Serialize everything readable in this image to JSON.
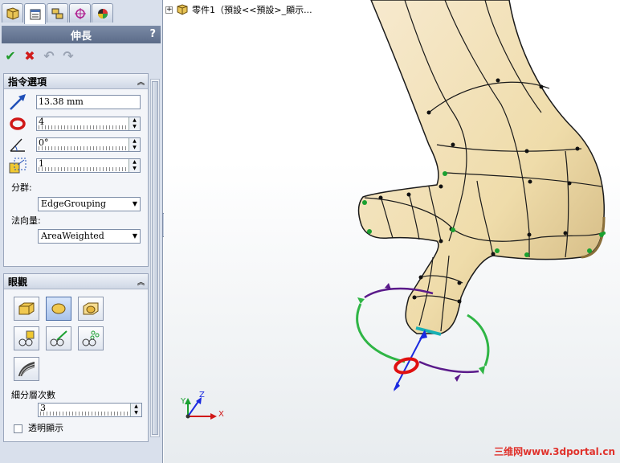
{
  "tabs": [
    "feature-manager",
    "property-manager",
    "configuration-manager",
    "dimxpert-manager",
    "display-manager"
  ],
  "property_manager": {
    "title": "伸長",
    "help": "?",
    "actions": [
      "ok",
      "cancel",
      "undo",
      "redo"
    ]
  },
  "options_group": {
    "title": "指令選項",
    "distance": "13.38 mm",
    "count": "4",
    "angle": "0°",
    "scale": "1",
    "grouping_label": "分群:",
    "grouping_value": "EdgeGrouping",
    "normal_label": "法向量:",
    "normal_value": "AreaWeighted"
  },
  "display_group": {
    "title": "眼觀",
    "subdivision_label": "細分層次數",
    "subdivision_value": "3",
    "transparent_label": "透明顯示",
    "transparent_checked": false
  },
  "tree": {
    "node": "零件1（預設<<預設>_顯示..."
  },
  "triad": {
    "x": "X",
    "y": "Y",
    "z": "Z"
  },
  "watermark": "三维网www.3dportal.cn",
  "colors": {
    "model_fill": "#efdcaa",
    "model_edge": "#1a1a1a",
    "handle_green": "#2fb545",
    "handle_purple": "#5a1a8a",
    "handle_red": "#e01010",
    "handle_blue": "#1a2ae0",
    "watermark": "#e0322c"
  }
}
